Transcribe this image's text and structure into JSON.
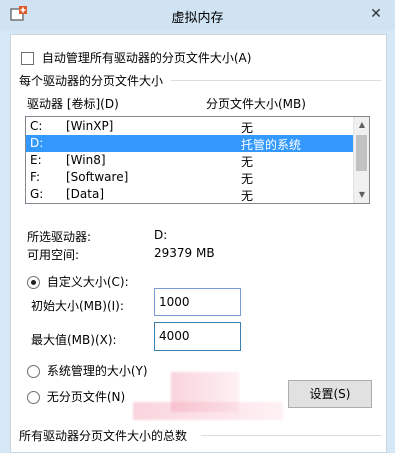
{
  "window": {
    "title": "虚拟内存",
    "close_glyph": "✕"
  },
  "auto_manage": {
    "label": "自动管理所有驱动器的分页文件大小(A)",
    "checked": false
  },
  "per_drive_group": {
    "label": "每个驱动器的分页文件大小"
  },
  "drive_list": {
    "header_drive": "驱动器 [卷标](D)",
    "header_size": "分页文件大小(MB)",
    "rows": [
      {
        "drive": "C:",
        "volume": "[WinXP]",
        "size": "无",
        "selected": false
      },
      {
        "drive": "D:",
        "volume": "",
        "size": "托管的系统",
        "selected": true
      },
      {
        "drive": "E:",
        "volume": "[Win8]",
        "size": "无",
        "selected": false
      },
      {
        "drive": "F:",
        "volume": "[Software]",
        "size": "无",
        "selected": false
      },
      {
        "drive": "G:",
        "volume": "[Data]",
        "size": "无",
        "selected": false
      }
    ]
  },
  "selected_drive": {
    "label": "所选驱动器:",
    "value": "D:"
  },
  "free_space": {
    "label": "可用空间:",
    "value": "29379 MB"
  },
  "options": {
    "custom_size": {
      "label": "自定义大小(C):",
      "selected": true
    },
    "initial_size": {
      "label": "初始大小(MB)(I):",
      "value": "1000"
    },
    "max_size": {
      "label": "最大值(MB)(X):",
      "value": "4000"
    },
    "system_managed": {
      "label": "系统管理的大小(Y)",
      "selected": false
    },
    "no_paging": {
      "label": "无分页文件(N)",
      "selected": false
    },
    "set_button": "设置(S)"
  },
  "total_group": {
    "label": "所有驱动器分页文件大小的总数"
  },
  "colors": {
    "selection": "#3399ff",
    "title_bar": "#cfe3f3"
  }
}
